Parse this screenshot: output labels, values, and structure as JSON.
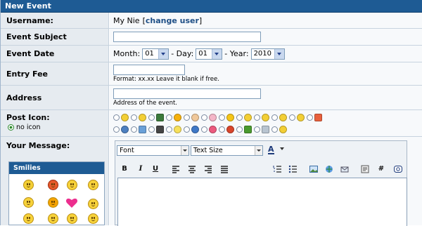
{
  "panel_title": "New Event",
  "username": {
    "label": "Username:",
    "value": "My Nie",
    "bracket_open": "[",
    "change_link": "change user",
    "bracket_close": "]"
  },
  "subject": {
    "label": "Event Subject",
    "value": ""
  },
  "date": {
    "label": "Event Date",
    "month_label": "Month:",
    "month_value": "01",
    "day_label": "- Day:",
    "day_value": "01",
    "year_label": "- Year:",
    "year_value": "2010"
  },
  "fee": {
    "label": "Entry Fee",
    "value": "",
    "hint": "Format: xx.xx Leave it blank if free."
  },
  "address": {
    "label": "Address",
    "value": "",
    "hint": "Address of the event."
  },
  "post_icon": {
    "label": "Post Icon:",
    "no_icon": "no icon",
    "row1": [
      "smile",
      "grin",
      "film",
      "yellow-face",
      "thumbs-up",
      "heart-outline",
      "star",
      "face",
      "face2",
      "face3",
      "face4",
      "rainbow"
    ],
    "row2": [
      "question",
      "picture",
      "music",
      "bulb",
      "info",
      "heart",
      "exclamation",
      "splat",
      "box",
      "face5"
    ]
  },
  "message": {
    "label": "Your Message:",
    "font_select": "Font",
    "size_select": "Text Size",
    "color_button": "A",
    "toolbar": {
      "bold": "B",
      "italic": "I",
      "underline": "U",
      "code": "#"
    },
    "body": ""
  },
  "smilies": {
    "title": "Smilies"
  },
  "colors": {
    "header": "#1e5b94",
    "label_bg": "#e6ebf0",
    "link": "#1e4f86"
  }
}
